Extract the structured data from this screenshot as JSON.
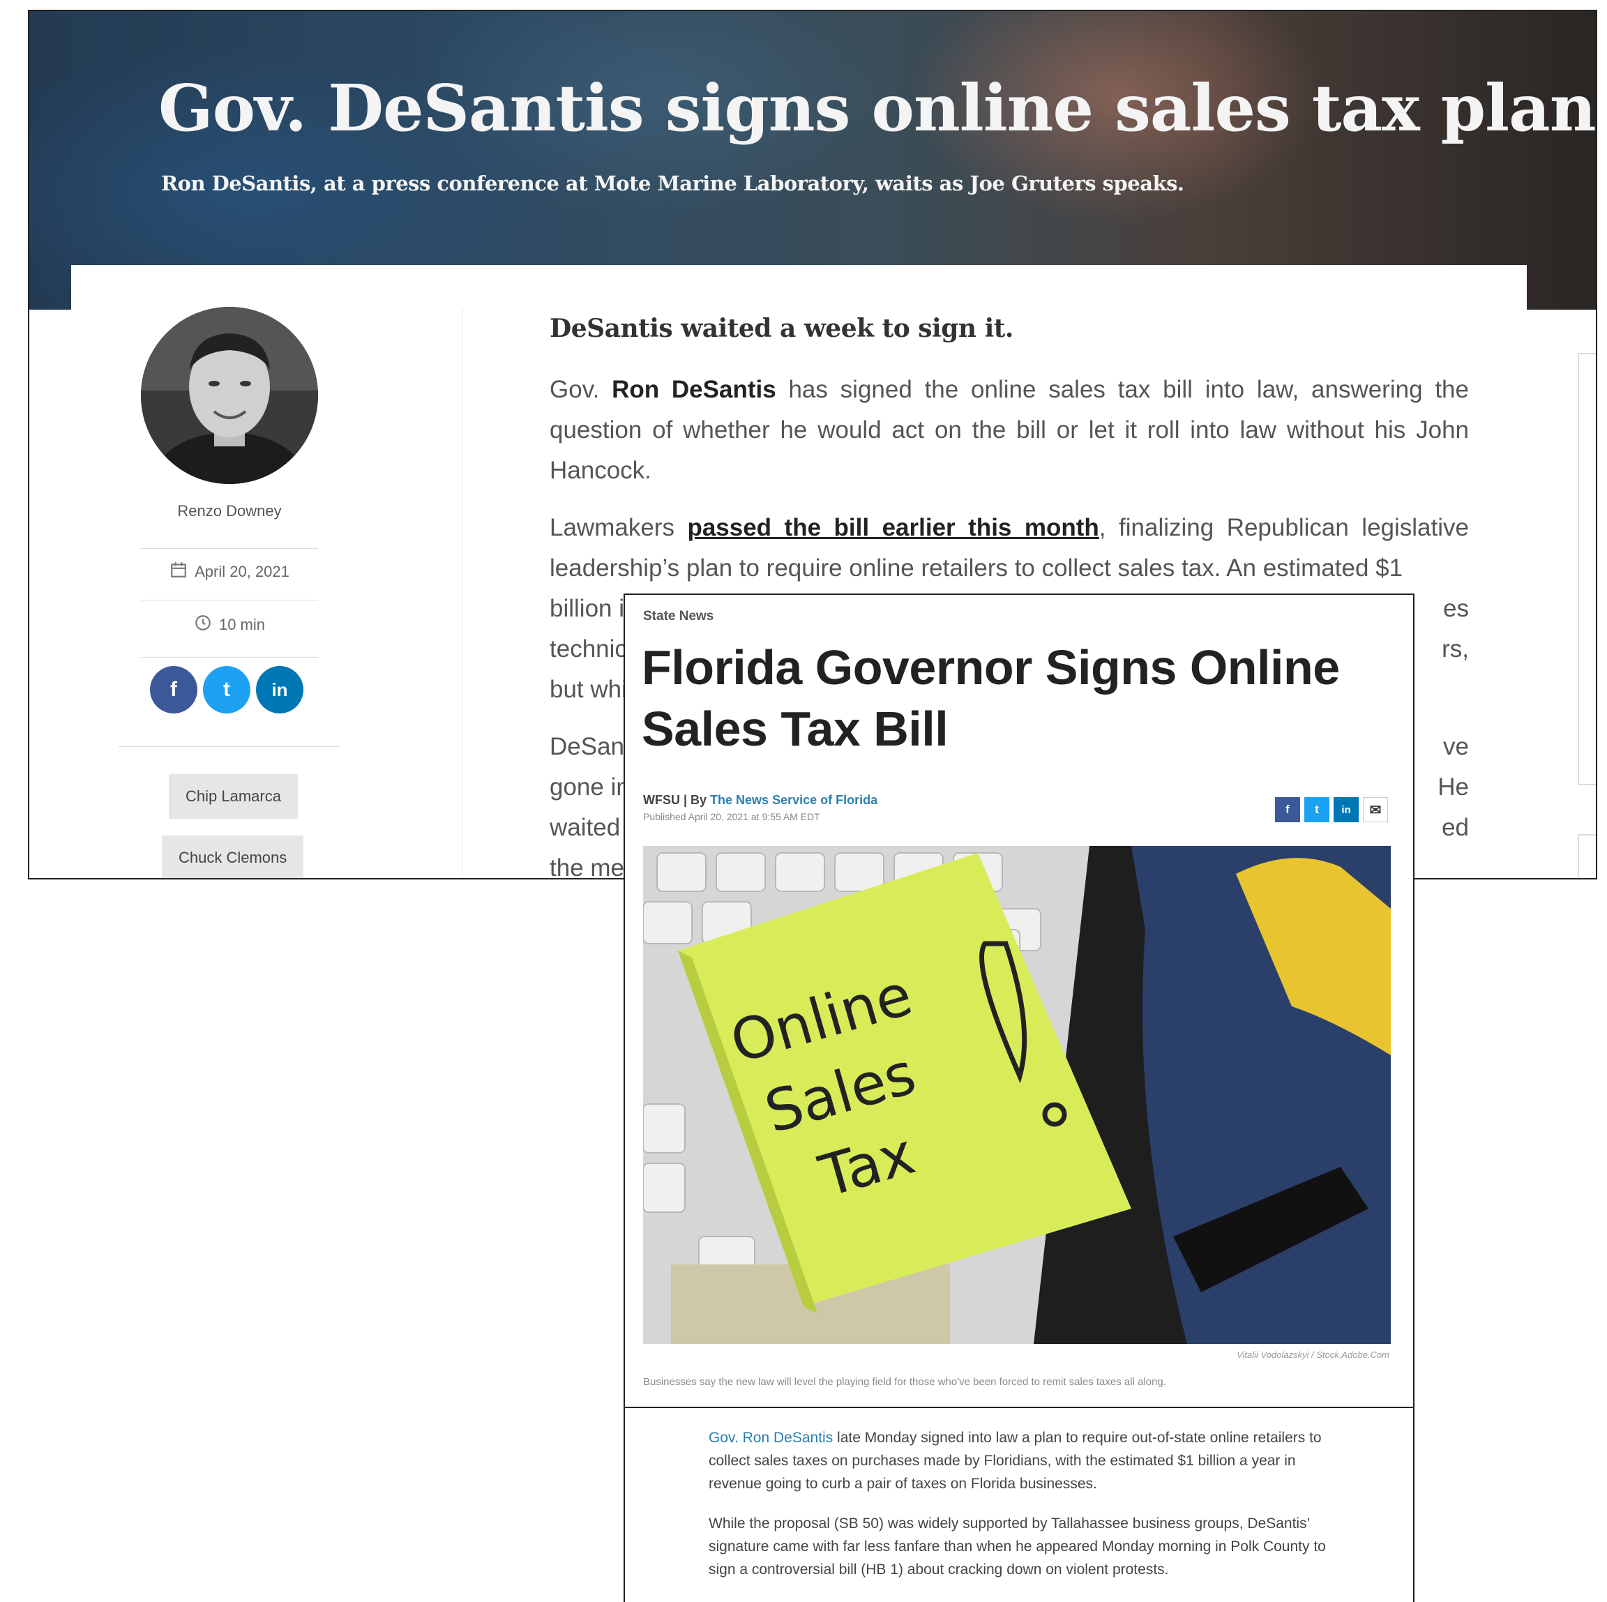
{
  "article_a": {
    "title": "Gov. DeSantis signs online sales tax plan",
    "caption": "Ron DeSantis, at a press conference at Mote Marine Laboratory, waits as Joe Gruters speaks.",
    "author": "Renzo Downey",
    "date": "April 20, 2021",
    "read_time": "10 min",
    "share_labels": [
      "f",
      "t",
      "in"
    ],
    "tags": [
      "Chip Lamarca",
      "Chuck Clemons"
    ],
    "lede": "DeSantis waited a week to sign it.",
    "p1_pre": "Gov. ",
    "p1_bold": "Ron DeSantis",
    "p1_post": " has signed the online sales tax bill into law, answering the question of whether he would act on the bill or let it roll into law without his John Hancock.",
    "p2_pre": "Lawmakers ",
    "p2_link": "passed the bill earlier this month",
    "p2_post": ", finalizing Republican legislative leadership’s plan to require online retailers to collect sales tax. An estimated $1",
    "p2_l3a": "billion in",
    "p2_l3b": "es",
    "p2_l4a": "technical",
    "p2_l4b": "rs,",
    "p2_l5a": "but which",
    "p3_l1a": "DeSantis",
    "p3_l1b": "ve",
    "p3_l2a": "gone into",
    "p3_l2b": "He",
    "p3_l3a": "waited un",
    "p3_l3b": "ed",
    "p3_l4a": "the meas"
  },
  "article_b": {
    "kicker": "State News",
    "title": "Florida Governor Signs Online Sales Tax Bill",
    "byline_prefix": "WFSU | By ",
    "byline_org": "The News Service of Florida",
    "published": "Published April 20, 2021 at 9:55 AM EDT",
    "share_labels": [
      "f",
      "t",
      "in",
      "✉"
    ],
    "photo_note_lines": [
      "Online",
      "Sales",
      "Tax"
    ],
    "photo_credit": "Vitalii Vodolazskyi / Stock.Adobe.Com",
    "photo_caption": "Businesses say the new law will level the playing field for those who've been forced to remit sales taxes all along.",
    "p1_link": "Gov. Ron DeSantis",
    "p1_text": " late Monday signed into law a plan to require out-of-state online retailers to collect sales taxes on purchases made by Floridians, with the estimated $1 billion a year in revenue going to curb a pair of taxes on Florida businesses.",
    "p2_text": "While the proposal (SB 50) was widely supported by Tallahassee business groups, DeSantis’ signature came with far less fanfare than when he appeared Monday morning in Polk County to sign a controversial bill (HB 1) about cracking down on violent protests."
  },
  "colors": {
    "facebook": "#3b5998",
    "twitter": "#1da1f2",
    "linkedin": "#0077b5",
    "link_b": "#2a7fb0",
    "note_yellow": "#d8ec5a"
  }
}
